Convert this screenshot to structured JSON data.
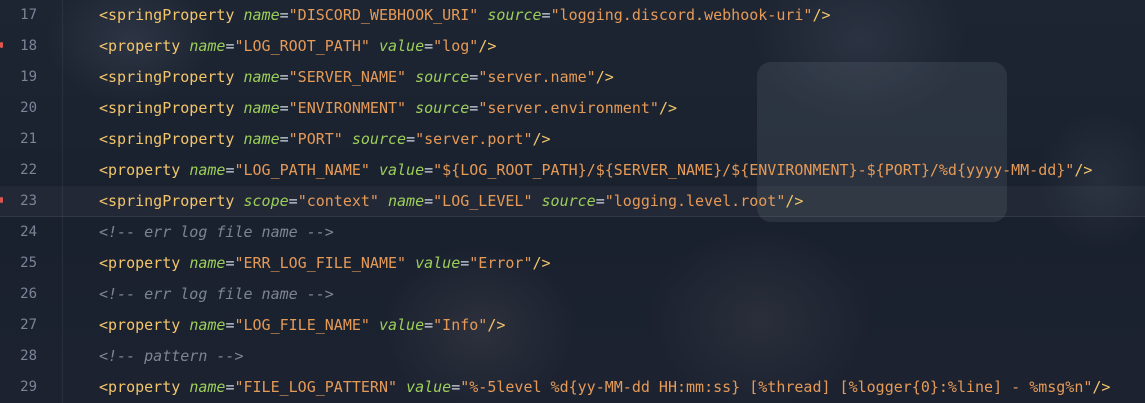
{
  "editor": {
    "lines": [
      {
        "number": "17",
        "marker": false,
        "parts": [
          {
            "t": "<springProperty",
            "c": "tag"
          },
          {
            "t": " "
          },
          {
            "t": "name",
            "c": "attr"
          },
          {
            "t": "=",
            "c": "eq"
          },
          {
            "t": "\"DISCORD_WEBHOOK_URI\"",
            "c": "str"
          },
          {
            "t": " "
          },
          {
            "t": "source",
            "c": "attr"
          },
          {
            "t": "=",
            "c": "eq"
          },
          {
            "t": "\"logging.discord.webhook-uri\"",
            "c": "str"
          },
          {
            "t": "/>",
            "c": "punct"
          }
        ]
      },
      {
        "number": "18",
        "marker": true,
        "parts": [
          {
            "t": "<property",
            "c": "tag"
          },
          {
            "t": " "
          },
          {
            "t": "name",
            "c": "attr"
          },
          {
            "t": "=",
            "c": "eq"
          },
          {
            "t": "\"LOG_ROOT_PATH\"",
            "c": "str"
          },
          {
            "t": " "
          },
          {
            "t": "value",
            "c": "attr"
          },
          {
            "t": "=",
            "c": "eq"
          },
          {
            "t": "\"log\"",
            "c": "str"
          },
          {
            "t": "/>",
            "c": "punct"
          }
        ]
      },
      {
        "number": "19",
        "marker": false,
        "parts": [
          {
            "t": "<springProperty",
            "c": "tag"
          },
          {
            "t": " "
          },
          {
            "t": "name",
            "c": "attr"
          },
          {
            "t": "=",
            "c": "eq"
          },
          {
            "t": "\"SERVER_NAME\"",
            "c": "str"
          },
          {
            "t": " "
          },
          {
            "t": "source",
            "c": "attr"
          },
          {
            "t": "=",
            "c": "eq"
          },
          {
            "t": "\"server.name\"",
            "c": "str"
          },
          {
            "t": "/>",
            "c": "punct"
          }
        ]
      },
      {
        "number": "20",
        "marker": false,
        "parts": [
          {
            "t": "<springProperty",
            "c": "tag"
          },
          {
            "t": " "
          },
          {
            "t": "name",
            "c": "attr"
          },
          {
            "t": "=",
            "c": "eq"
          },
          {
            "t": "\"ENVIRONMENT\"",
            "c": "str"
          },
          {
            "t": " "
          },
          {
            "t": "source",
            "c": "attr"
          },
          {
            "t": "=",
            "c": "eq"
          },
          {
            "t": "\"server.environment\"",
            "c": "str"
          },
          {
            "t": "/>",
            "c": "punct"
          }
        ]
      },
      {
        "number": "21",
        "marker": false,
        "parts": [
          {
            "t": "<springProperty",
            "c": "tag"
          },
          {
            "t": " "
          },
          {
            "t": "name",
            "c": "attr"
          },
          {
            "t": "=",
            "c": "eq"
          },
          {
            "t": "\"PORT\"",
            "c": "str"
          },
          {
            "t": " "
          },
          {
            "t": "source",
            "c": "attr"
          },
          {
            "t": "=",
            "c": "eq"
          },
          {
            "t": "\"server.port\"",
            "c": "str"
          },
          {
            "t": "/>",
            "c": "punct"
          }
        ]
      },
      {
        "number": "22",
        "marker": false,
        "parts": [
          {
            "t": "<property",
            "c": "tag"
          },
          {
            "t": " "
          },
          {
            "t": "name",
            "c": "attr"
          },
          {
            "t": "=",
            "c": "eq"
          },
          {
            "t": "\"LOG_PATH_NAME\"",
            "c": "str"
          },
          {
            "t": " "
          },
          {
            "t": "value",
            "c": "attr"
          },
          {
            "t": "=",
            "c": "eq"
          },
          {
            "t": "\"${LOG_ROOT_PATH}/${SERVER_NAME}/${ENVIRONMENT}-${PORT}/%d{yyyy-MM-dd}\"",
            "c": "str"
          },
          {
            "t": "/>",
            "c": "punct"
          }
        ]
      },
      {
        "number": "23",
        "marker": true,
        "current": true,
        "parts": [
          {
            "t": "<springProperty",
            "c": "tag"
          },
          {
            "t": " "
          },
          {
            "t": "scope",
            "c": "attr"
          },
          {
            "t": "=",
            "c": "eq"
          },
          {
            "t": "\"context\"",
            "c": "str"
          },
          {
            "t": " "
          },
          {
            "t": "name",
            "c": "attr"
          },
          {
            "t": "=",
            "c": "eq"
          },
          {
            "t": "\"LOG_LEVEL\"",
            "c": "str"
          },
          {
            "t": " "
          },
          {
            "t": "source",
            "c": "attr"
          },
          {
            "t": "=",
            "c": "eq"
          },
          {
            "t": "\"logging.level.root\"",
            "c": "str"
          },
          {
            "t": "/>",
            "c": "punct"
          }
        ]
      },
      {
        "number": "24",
        "marker": false,
        "parts": [
          {
            "t": "<!-- err log file name -->",
            "c": "comment"
          }
        ]
      },
      {
        "number": "25",
        "marker": false,
        "parts": [
          {
            "t": "<property",
            "c": "tag"
          },
          {
            "t": " "
          },
          {
            "t": "name",
            "c": "attr"
          },
          {
            "t": "=",
            "c": "eq"
          },
          {
            "t": "\"ERR_LOG_FILE_NAME\"",
            "c": "str"
          },
          {
            "t": " "
          },
          {
            "t": "value",
            "c": "attr"
          },
          {
            "t": "=",
            "c": "eq"
          },
          {
            "t": "\"Error\"",
            "c": "str"
          },
          {
            "t": "/>",
            "c": "punct"
          }
        ]
      },
      {
        "number": "26",
        "marker": false,
        "parts": [
          {
            "t": "<!-- err log file name -->",
            "c": "comment"
          }
        ]
      },
      {
        "number": "27",
        "marker": false,
        "parts": [
          {
            "t": "<property",
            "c": "tag"
          },
          {
            "t": " "
          },
          {
            "t": "name",
            "c": "attr"
          },
          {
            "t": "=",
            "c": "eq"
          },
          {
            "t": "\"LOG_FILE_NAME\"",
            "c": "str"
          },
          {
            "t": " "
          },
          {
            "t": "value",
            "c": "attr"
          },
          {
            "t": "=",
            "c": "eq"
          },
          {
            "t": "\"Info\"",
            "c": "str"
          },
          {
            "t": "/>",
            "c": "punct"
          }
        ]
      },
      {
        "number": "28",
        "marker": false,
        "parts": [
          {
            "t": "<!-- pattern -->",
            "c": "comment"
          }
        ]
      },
      {
        "number": "29",
        "marker": false,
        "parts": [
          {
            "t": "<property",
            "c": "tag"
          },
          {
            "t": " "
          },
          {
            "t": "name",
            "c": "attr"
          },
          {
            "t": "=",
            "c": "eq"
          },
          {
            "t": "\"FILE_LOG_PATTERN\"",
            "c": "str"
          },
          {
            "t": " "
          },
          {
            "t": "value",
            "c": "attr"
          },
          {
            "t": "=",
            "c": "eq"
          },
          {
            "t": "\"%-5level %d{yy-MM-dd HH:mm:ss} [%thread] [%logger{0}:%line] - %msg%n\"",
            "c": "str"
          },
          {
            "t": "/>",
            "c": "punct"
          }
        ]
      }
    ]
  },
  "colors": {
    "background": "#1a2130",
    "tag": "#f2c56b",
    "attribute": "#9ccf5a",
    "string": "#e59a57",
    "comment": "#7d8595",
    "line_number": "#7c8598",
    "change_marker": "#e0564f"
  }
}
